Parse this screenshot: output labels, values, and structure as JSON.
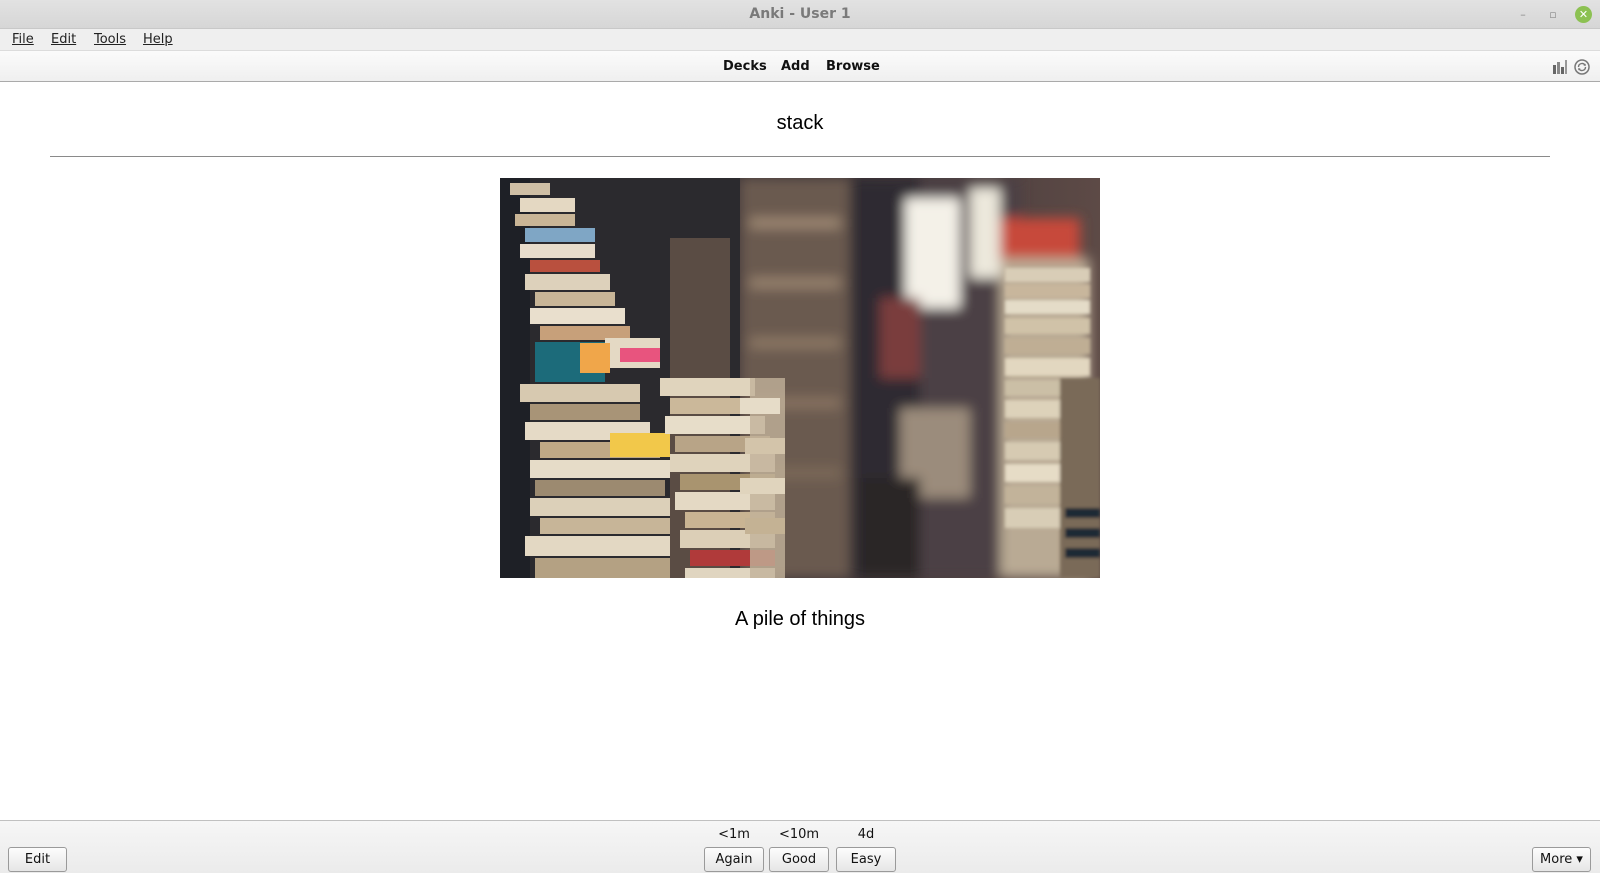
{
  "window": {
    "title": "Anki - User 1",
    "controls": {
      "minimize_glyph": "–",
      "maximize_glyph": "▫",
      "close_glyph": "✕",
      "close_color": "#8cc152"
    }
  },
  "menubar": {
    "items": [
      {
        "label": "File"
      },
      {
        "label": "Edit"
      },
      {
        "label": "Tools"
      },
      {
        "label": "Help"
      }
    ]
  },
  "toolbar": {
    "links": [
      {
        "label": "Decks"
      },
      {
        "label": "Add"
      },
      {
        "label": "Browse"
      }
    ],
    "icons": [
      "stats-icon",
      "sync-icon"
    ]
  },
  "card": {
    "front": "stack",
    "image": "books-stack-photo",
    "back": "A pile of things"
  },
  "bottombar": {
    "edit_label": "Edit",
    "answers": [
      {
        "interval": "<1m",
        "label": "Again"
      },
      {
        "interval": "<10m",
        "label": "Good"
      },
      {
        "interval": "4d",
        "label": "Easy"
      }
    ],
    "more_label": "More ▾"
  }
}
